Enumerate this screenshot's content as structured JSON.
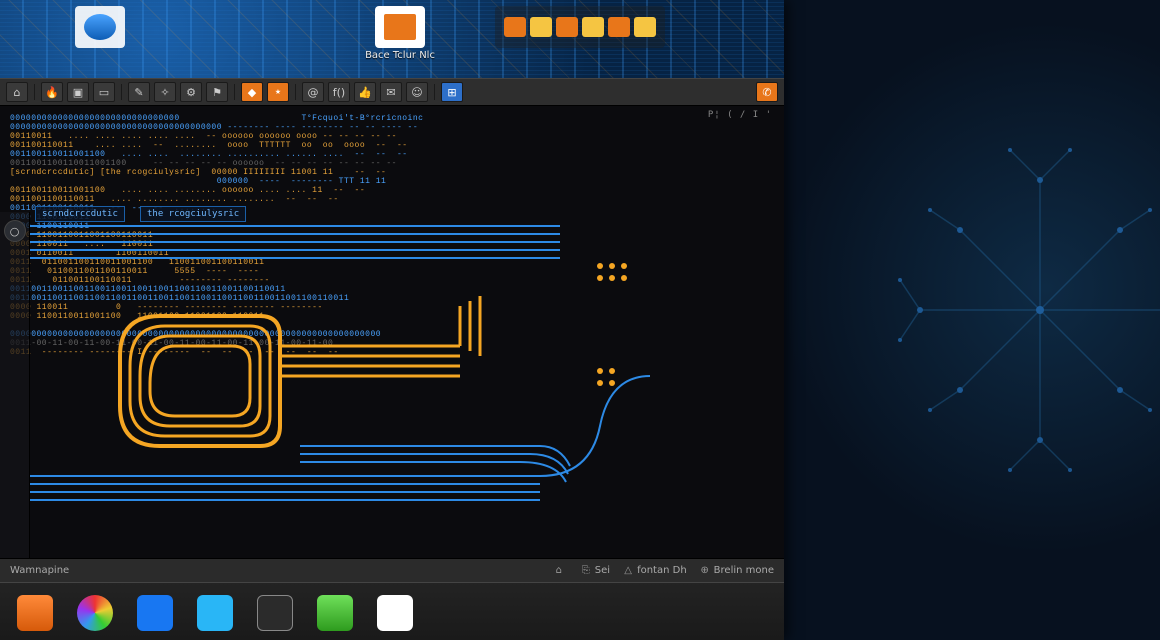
{
  "desktop": {
    "icons": [
      {
        "label": ""
      },
      {
        "label": "Bace Tclur Nlc"
      },
      {
        "label": ""
      }
    ]
  },
  "toolbar": {
    "buttons": [
      {
        "glyph": "⌂",
        "name": "home-icon"
      },
      {
        "glyph": "🔥",
        "name": "flame-icon"
      },
      {
        "glyph": "▣",
        "name": "grid-icon"
      },
      {
        "glyph": "▭",
        "name": "window-icon"
      },
      {
        "glyph": "✎",
        "name": "pencil-icon"
      },
      {
        "glyph": "✧",
        "name": "spark-icon"
      },
      {
        "glyph": "⚙",
        "name": "gear-icon"
      },
      {
        "glyph": "⚑",
        "name": "flag-icon"
      },
      {
        "glyph": "◆",
        "name": "diamond-icon"
      },
      {
        "glyph": "⭑",
        "name": "star-icon"
      },
      {
        "glyph": "@",
        "name": "at-icon"
      },
      {
        "glyph": "f()",
        "name": "function-icon"
      },
      {
        "glyph": "👍",
        "name": "thumb-icon"
      },
      {
        "glyph": "✉",
        "name": "mail-icon"
      },
      {
        "glyph": "☺",
        "name": "face-icon"
      },
      {
        "glyph": "⊞",
        "name": "apps-icon"
      },
      {
        "glyph": "✆",
        "name": "phone-icon"
      }
    ]
  },
  "canvas": {
    "info_header": "P¦ ( / I '",
    "chip1": "the rcogciulysric",
    "chip0": "scrndcrccdutic",
    "ascii": [
      "00000000000000000000000000000000                       T°Fcquoi't-B°rcricnoinc",
      "0000000000000000000000000000000000000000 -------- ---- -------- -- -- ---- --",
      "00110011   .... .... .... .... ....  -- oooooo oooooo oooo -- -- -- -- --",
      "001100110011    .... ....  --  ........  oooo  TTTTTT  oo  oo  oooo  --  --",
      "001100110011001100   .... ....  ........ .......... ...... ....  --  --  --",
      "0011001100110011001100     -- -- -- -- -- oooooo  -- -- -- -- -- -- -- --",
      "[scrndcrccdutic] [the rcogciulysric]  00000 IIIIIIII 11001 11    --  --",
      "                                       000000  ----  -------- TTT 11 11",
      "001100110011001100   .... .... ........ oooooo .... .... 11  --  --",
      "0011001100110011   .... ........ ........ ........  --  --  --",
      "0011001100110011   --  --  --  ........",
      "0000 1100110011",
      "0000 1100110011",
      "0000 1100110011001100110011",
      "0000 110011   ....   110011",
      "0001 0110011        1100110011",
      "0011  011001100110011001100   110011001100110011",
      "0011   0110011001100110011     5555  ----  ----",
      "0011    011001100110011         -------- --------",
      "0011001100110011001100110011001100110011001100110011",
      "0011001100110011001100110011001100110011001100110011001100110011",
      "0000 110011         0   -------- -------- -------- --------",
      "0000 1100110011001100   11001100 11001100 110011",
      " ",
      "0000000000000000000000000000000000000000000000000000000000000000000000",
      "0011-00-11-00-11-00-11-00-11-00-11-00-11-00-11-00-11-00-11-00",
      "0011  -------- -------- I --------  --  --  --  --  --  --  --"
    ],
    "ascii_colors": [
      "b",
      "b",
      "o",
      "o",
      "b",
      "d",
      "o",
      "b",
      "o",
      "o",
      "b",
      "b",
      "b",
      "o",
      "o",
      "o",
      "o",
      "o",
      "o",
      "b",
      "b",
      "o",
      "o",
      "d",
      "b",
      "d",
      "o"
    ]
  },
  "statusbar": {
    "left": "Wamnapine",
    "items": [
      {
        "icon": "⌂",
        "label": ""
      },
      {
        "icon": "⎘",
        "label": "Sei"
      },
      {
        "icon": "△",
        "label": "fontan Dh"
      },
      {
        "icon": "⊕",
        "label": "Brelin mone"
      }
    ]
  },
  "dock": {
    "items": [
      {
        "name": "launcher"
      },
      {
        "name": "browser"
      },
      {
        "name": "social"
      },
      {
        "name": "chat"
      },
      {
        "name": "terminal"
      },
      {
        "name": "game"
      },
      {
        "name": "files"
      }
    ]
  },
  "launcher": {
    "items": [
      {
        "glyph": "○",
        "name": "tool-select"
      },
      {
        "glyph": "◐",
        "name": "tool-pan"
      },
      {
        "glyph": "⊙",
        "name": "tool-target"
      }
    ]
  }
}
